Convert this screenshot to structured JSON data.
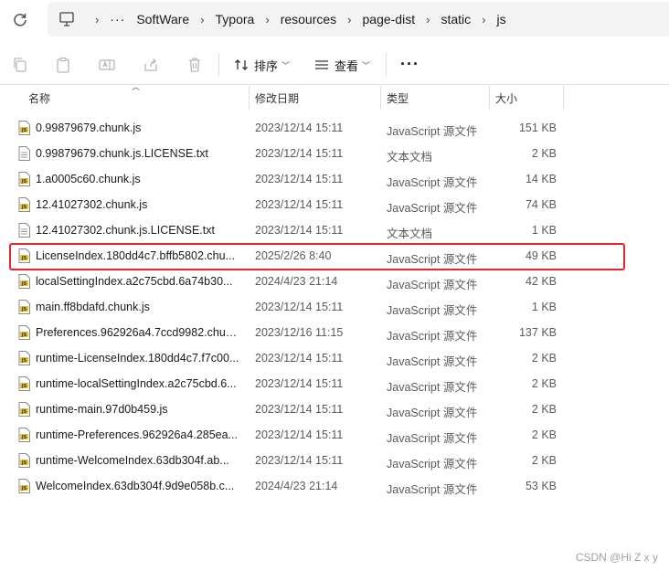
{
  "breadcrumb": {
    "overflow": "···",
    "items": [
      "SoftWare",
      "Typora",
      "resources",
      "page-dist",
      "static",
      "js"
    ]
  },
  "toolbar": {
    "sort_label": "排序",
    "view_label": "查看",
    "more_label": "···"
  },
  "columns": {
    "name": "名称",
    "modified": "修改日期",
    "type": "类型",
    "size": "大小"
  },
  "files": [
    {
      "name": "0.99879679.chunk.js",
      "date": "2023/12/14 15:11",
      "type": "JavaScript 源文件",
      "size": "151 KB",
      "icon": "js-file-icon"
    },
    {
      "name": "0.99879679.chunk.js.LICENSE.txt",
      "date": "2023/12/14 15:11",
      "type": "文本文档",
      "size": "2 KB",
      "icon": "text-file-icon"
    },
    {
      "name": "1.a0005c60.chunk.js",
      "date": "2023/12/14 15:11",
      "type": "JavaScript 源文件",
      "size": "14 KB",
      "icon": "js-file-icon"
    },
    {
      "name": "12.41027302.chunk.js",
      "date": "2023/12/14 15:11",
      "type": "JavaScript 源文件",
      "size": "74 KB",
      "icon": "js-file-icon"
    },
    {
      "name": "12.41027302.chunk.js.LICENSE.txt",
      "date": "2023/12/14 15:11",
      "type": "文本文档",
      "size": "1 KB",
      "icon": "text-file-icon"
    },
    {
      "name": "LicenseIndex.180dd4c7.bffb5802.chu...",
      "date": "2025/2/26 8:40",
      "type": "JavaScript 源文件",
      "size": "49 KB",
      "icon": "js-file-icon"
    },
    {
      "name": "localSettingIndex.a2c75cbd.6a74b30...",
      "date": "2024/4/23 21:14",
      "type": "JavaScript 源文件",
      "size": "42 KB",
      "icon": "js-file-icon"
    },
    {
      "name": "main.ff8bdafd.chunk.js",
      "date": "2023/12/14 15:11",
      "type": "JavaScript 源文件",
      "size": "1 KB",
      "icon": "js-file-icon"
    },
    {
      "name": "Preferences.962926a4.7ccd9982.chun...",
      "date": "2023/12/16 11:15",
      "type": "JavaScript 源文件",
      "size": "137 KB",
      "icon": "js-file-icon"
    },
    {
      "name": "runtime-LicenseIndex.180dd4c7.f7c00...",
      "date": "2023/12/14 15:11",
      "type": "JavaScript 源文件",
      "size": "2 KB",
      "icon": "js-file-icon"
    },
    {
      "name": "runtime-localSettingIndex.a2c75cbd.6...",
      "date": "2023/12/14 15:11",
      "type": "JavaScript 源文件",
      "size": "2 KB",
      "icon": "js-file-icon"
    },
    {
      "name": "runtime-main.97d0b459.js",
      "date": "2023/12/14 15:11",
      "type": "JavaScript 源文件",
      "size": "2 KB",
      "icon": "js-file-icon"
    },
    {
      "name": "runtime-Preferences.962926a4.285ea...",
      "date": "2023/12/14 15:11",
      "type": "JavaScript 源文件",
      "size": "2 KB",
      "icon": "js-file-icon"
    },
    {
      "name": "runtime-WelcomeIndex.63db304f.ab...",
      "date": "2023/12/14 15:11",
      "type": "JavaScript 源文件",
      "size": "2 KB",
      "icon": "js-file-icon"
    },
    {
      "name": "WelcomeIndex.63db304f.9d9e058b.c...",
      "date": "2024/4/23 21:14",
      "type": "JavaScript 源文件",
      "size": "53 KB",
      "icon": "js-file-icon"
    }
  ],
  "highlight_row": 5,
  "watermark": "CSDN @Hi Z x y",
  "colors": {
    "highlight": "#e8242f",
    "js_icon": "#e3c22b"
  }
}
